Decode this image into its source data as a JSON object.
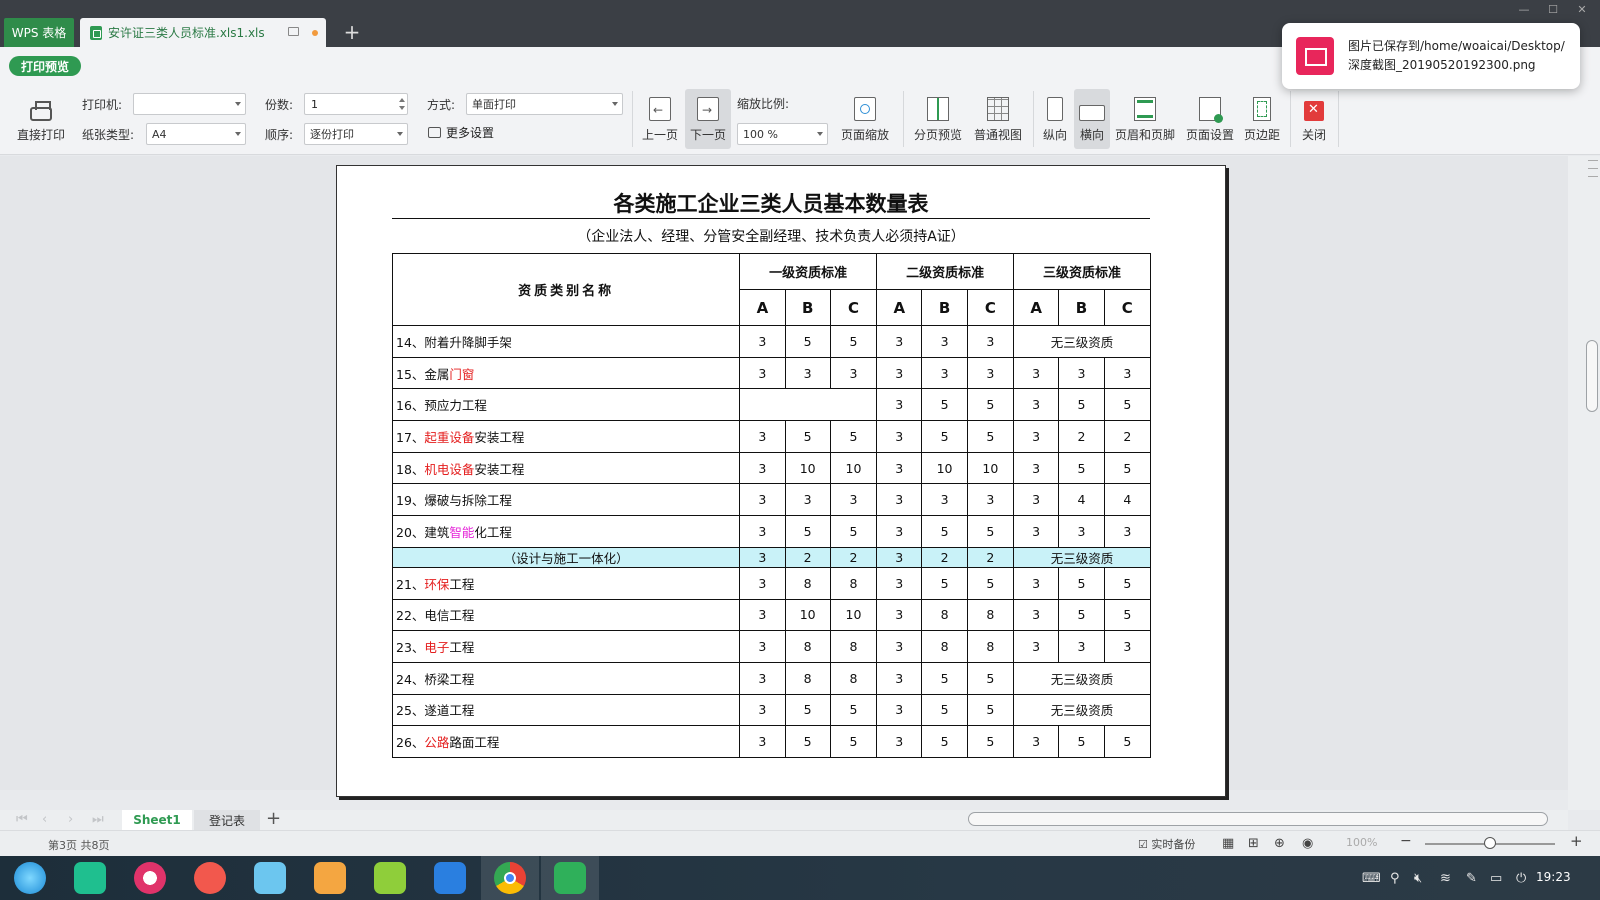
{
  "titlebar": {
    "app_tab": "WPS 表格",
    "doc_tab": "安许证三类人员标准.xls1.xls",
    "add_tab": "+"
  },
  "modebar": {
    "preview_label": "打印预览"
  },
  "toolbar": {
    "direct_print": "直接打印",
    "printer_label": "打印机:",
    "printer_value": "",
    "paper_label": "纸张类型:",
    "paper_value": "A4",
    "copies_label": "份数:",
    "copies_value": "1",
    "order_label": "顺序:",
    "order_value": "逐份打印",
    "mode_label": "方式:",
    "mode_value": "单面打印",
    "more_settings": "更多设置",
    "prev_page": "上一页",
    "next_page": "下一页",
    "zoom_label": "缩放比例:",
    "zoom_value": "100 %",
    "page_zoom": "页面缩放",
    "split_preview": "分页预览",
    "normal_view": "普通视图",
    "portrait": "纵向",
    "landscape": "横向",
    "header_footer": "页眉和页脚",
    "page_setup": "页面设置",
    "margins": "页边距",
    "close": "关闭"
  },
  "document": {
    "title": "各类施工企业三类人员基本数量表",
    "subtitle": "（企业法人、经理、分管安全副经理、技术负责人必须持A证）",
    "header": {
      "name_col": "资质类别名称",
      "level1": "一级资质标准",
      "level2": "二级资质标准",
      "level3": "三级资质标准",
      "sub": [
        "A",
        "B",
        "C",
        "A",
        "B",
        "C",
        "A",
        "B",
        "C"
      ]
    },
    "no_level3": "无三级资质",
    "rows": [
      {
        "prefix": "14、附着升降脚手架",
        "red": "",
        "suffix": "",
        "v": [
          "3",
          "5",
          "5",
          "3",
          "3",
          "3"
        ],
        "l3": "none"
      },
      {
        "prefix": "15、金属",
        "red": "门窗",
        "suffix": "",
        "v": [
          "3",
          "3",
          "3",
          "3",
          "3",
          "3",
          "3",
          "3",
          "3"
        ]
      },
      {
        "prefix": "16、预应力工程",
        "red": "",
        "suffix": "",
        "v": [
          "",
          "",
          "",
          "3",
          "5",
          "5",
          "3",
          "5",
          "5"
        ],
        "l1": "blank"
      },
      {
        "prefix": "17、",
        "red": "起重设备",
        "suffix": "安装工程",
        "v": [
          "3",
          "5",
          "5",
          "3",
          "5",
          "5",
          "3",
          "2",
          "2"
        ]
      },
      {
        "prefix": "18、",
        "red": "机电设备",
        "suffix": "安装工程",
        "v": [
          "3",
          "10",
          "10",
          "3",
          "10",
          "10",
          "3",
          "5",
          "5"
        ]
      },
      {
        "prefix": "19、爆破与拆除工程",
        "red": "",
        "suffix": "",
        "v": [
          "3",
          "3",
          "3",
          "3",
          "3",
          "3",
          "3",
          "4",
          "4"
        ]
      },
      {
        "prefix": "20、建筑",
        "magenta": "智能",
        "suffix": "化工程",
        "v": [
          "3",
          "5",
          "5",
          "3",
          "5",
          "5",
          "3",
          "3",
          "3"
        ]
      },
      {
        "highlight": true,
        "label": "（设计与施工一体化）",
        "v": [
          "3",
          "2",
          "2",
          "3",
          "2",
          "2"
        ],
        "l3": "none"
      },
      {
        "prefix": "21、",
        "red": "环保",
        "suffix": "工程",
        "v": [
          "3",
          "8",
          "8",
          "3",
          "5",
          "5",
          "3",
          "5",
          "5"
        ],
        "red_cells": [
          7,
          8
        ]
      },
      {
        "prefix": "22、电信工程",
        "red": "",
        "suffix": "",
        "v": [
          "3",
          "10",
          "10",
          "3",
          "8",
          "8",
          "3",
          "5",
          "5"
        ]
      },
      {
        "prefix": "23、",
        "red": "电子",
        "suffix": "工程",
        "v": [
          "3",
          "8",
          "8",
          "3",
          "8",
          "8",
          "3",
          "3",
          "3"
        ]
      },
      {
        "prefix": "24、桥梁工程",
        "red": "",
        "suffix": "",
        "v": [
          "3",
          "8",
          "8",
          "3",
          "5",
          "5"
        ],
        "l3": "none"
      },
      {
        "prefix": "25、遂道工程",
        "red": "",
        "suffix": "",
        "v": [
          "3",
          "5",
          "5",
          "3",
          "5",
          "5"
        ],
        "l3": "none"
      },
      {
        "prefix": "26、",
        "red": "公路",
        "suffix": "路面工程",
        "v": [
          "3",
          "5",
          "5",
          "3",
          "5",
          "5",
          "3",
          "5",
          "5"
        ]
      }
    ]
  },
  "sheets": {
    "tab1": "Sheet1",
    "tab2": "登记表"
  },
  "status": {
    "page_info": "第3页 共8页",
    "backup": "实时备份",
    "zoom": "100%"
  },
  "notification": {
    "text": "图片已保存到/home/woaicai/Desktop/深度截图_20190520192300.png"
  },
  "taskbar": {
    "clock": "19:23"
  },
  "colors": {
    "accent": "#2f9a52",
    "highlight_row": "#c9f2f8",
    "red_text": "#e41e1e",
    "magenta_text": "#e524d8"
  }
}
